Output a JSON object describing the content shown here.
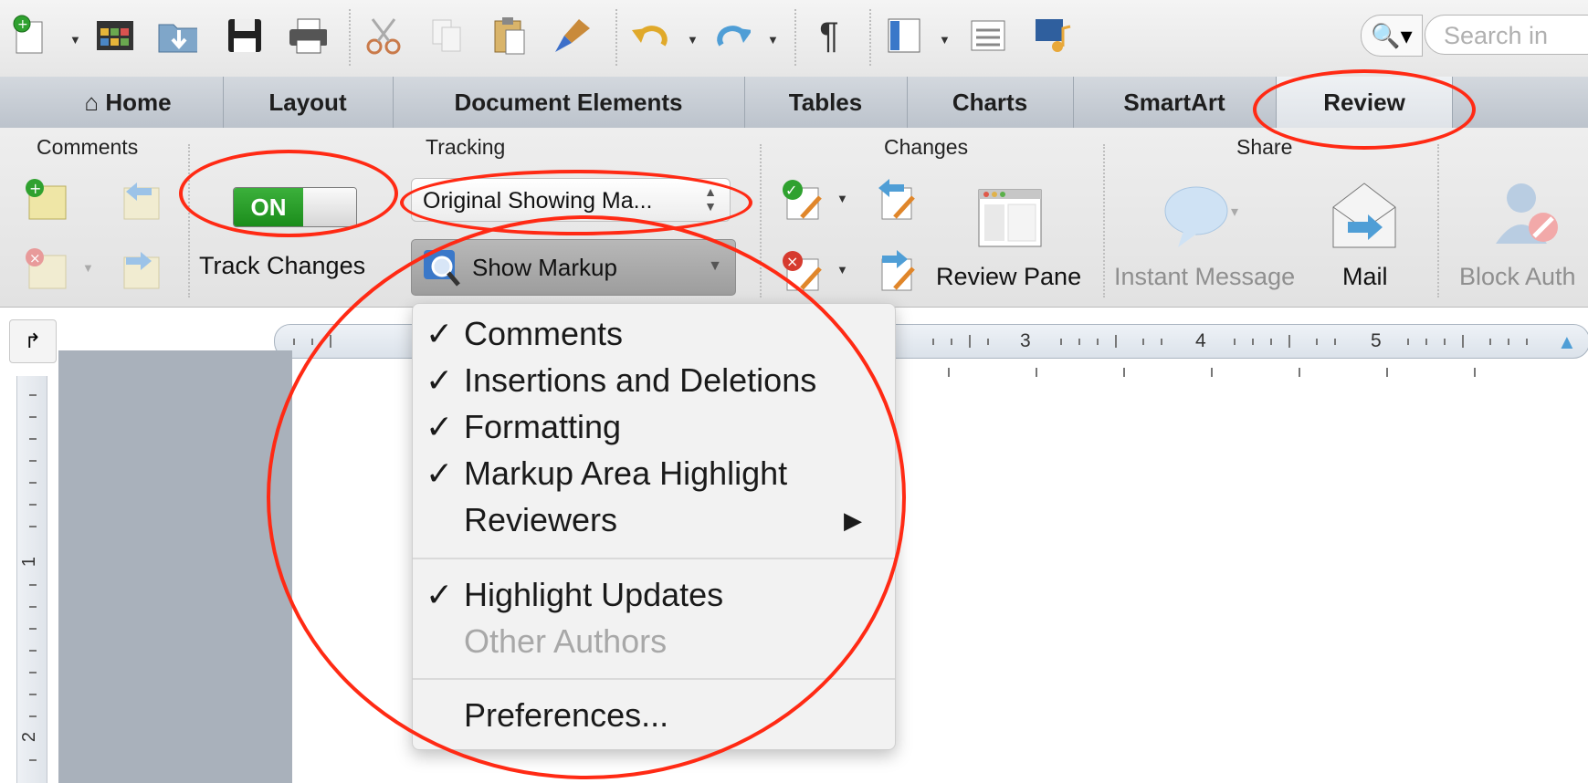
{
  "toolbar": {
    "icons": [
      "new-document-icon",
      "template-gallery-icon",
      "open-folder-icon",
      "save-icon",
      "print-icon",
      "cut-icon",
      "copy-icon",
      "paste-icon",
      "format-painter-icon",
      "undo-icon",
      "redo-icon",
      "pilcrow-icon",
      "sidebar-icon",
      "view-options-icon",
      "media-browser-icon"
    ],
    "pilcrow": "¶",
    "search_placeholder": "Search in"
  },
  "tabs": [
    {
      "label": "Home",
      "icon": "home-icon",
      "active": false
    },
    {
      "label": "Layout",
      "active": false
    },
    {
      "label": "Document Elements",
      "active": false
    },
    {
      "label": "Tables",
      "active": false
    },
    {
      "label": "Charts",
      "active": false
    },
    {
      "label": "SmartArt",
      "active": false
    },
    {
      "label": "Review",
      "active": true
    }
  ],
  "ribbon": {
    "groups": {
      "comments": "Comments",
      "tracking": "Tracking",
      "changes": "Changes",
      "share": "Share"
    },
    "toggle_on": "ON",
    "track_changes": "Track Changes",
    "display_mode": "Original Showing Ma...",
    "show_markup": "Show Markup",
    "review_pane": "Review Pane",
    "instant_message": "Instant Message",
    "mail": "Mail",
    "block_authors": "Block Auth"
  },
  "ruler": {
    "corner_symbol": "↱",
    "h_numbers": [
      "3",
      "4",
      "5"
    ],
    "v_numbers": [
      "1",
      "2"
    ]
  },
  "menu": {
    "items": [
      {
        "label": "Comments",
        "checked": true,
        "check": "✓"
      },
      {
        "label": "Insertions and Deletions",
        "checked": true,
        "check": "✓"
      },
      {
        "label": "Formatting",
        "checked": true,
        "check": "✓"
      },
      {
        "label": "Markup Area Highlight",
        "checked": true,
        "check": "✓"
      },
      {
        "label": "Reviewers",
        "checked": false,
        "submenu": "▶"
      },
      {
        "label": "Highlight Updates",
        "checked": true,
        "check": "✓"
      },
      {
        "label": "Other Authors",
        "checked": false,
        "disabled": true
      },
      {
        "label": "Preferences...",
        "checked": false
      }
    ]
  },
  "colors": {
    "annotation": "#ff2a14",
    "toggle_on": "#2a9e2a",
    "tab_bar": "#c6ccd4"
  }
}
